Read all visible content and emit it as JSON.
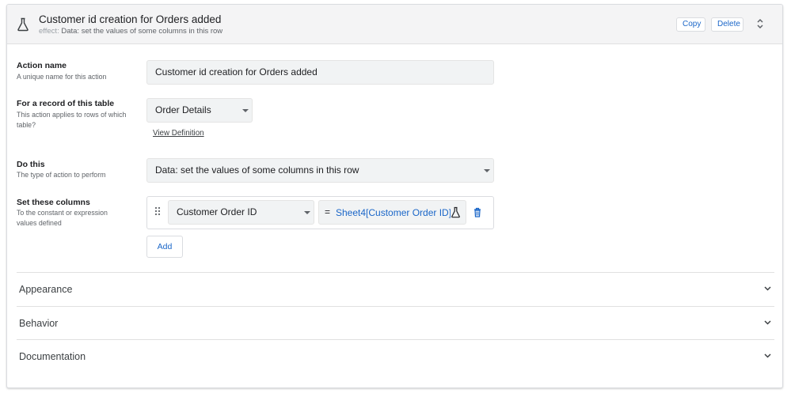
{
  "header": {
    "title": "Customer id creation for Orders added",
    "effect_label": "effect:",
    "effect_value": "Data: set the values of some columns in this row",
    "copy_label": "Copy",
    "delete_label": "Delete"
  },
  "fields": {
    "action_name": {
      "label": "Action name",
      "help": "A unique name for this action",
      "value": "Customer id creation for Orders added"
    },
    "table": {
      "label": "For a record of this table",
      "help": "This action applies to rows of which table?",
      "value": "Order Details",
      "link": "View Definition"
    },
    "do_this": {
      "label": "Do this",
      "help": "The type of action to perform",
      "value": "Data: set the values of some columns in this row"
    },
    "set_columns": {
      "label": "Set these columns",
      "help": "To the constant or expression values defined",
      "column": "Customer Order ID",
      "equals": "=",
      "expression": "Sheet4[Customer Order ID]",
      "add_label": "Add"
    }
  },
  "sections": [
    {
      "label": "Appearance"
    },
    {
      "label": "Behavior"
    },
    {
      "label": "Documentation"
    }
  ],
  "colors": {
    "accent": "#1a66c8",
    "header_bg": "#f4f4f5",
    "input_bg": "#f1f3f4"
  },
  "icons": [
    "flask-icon",
    "sort-icon",
    "caret-icon",
    "drag-handle-icon",
    "trash-icon",
    "chevron-down-icon"
  ]
}
